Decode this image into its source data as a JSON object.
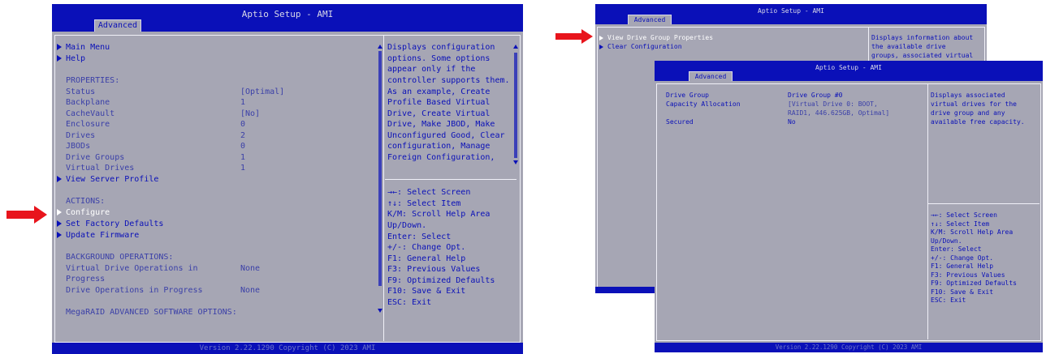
{
  "screen1": {
    "title": "Aptio Setup - AMI",
    "tab": "Advanced",
    "menu": [
      {
        "label": "Main Menu",
        "value": ""
      },
      {
        "label": "Help",
        "value": ""
      }
    ],
    "properties_header": "PROPERTIES:",
    "properties": [
      {
        "label": "Status",
        "value": "[Optimal]"
      },
      {
        "label": "Backplane",
        "value": "1"
      },
      {
        "label": "CacheVault",
        "value": "[No]"
      },
      {
        "label": "Enclosure",
        "value": "0"
      },
      {
        "label": "Drives",
        "value": "2"
      },
      {
        "label": "JBODs",
        "value": "0"
      },
      {
        "label": "Drive Groups",
        "value": "1"
      },
      {
        "label": "Virtual Drives",
        "value": "1"
      }
    ],
    "view_server_profile": "View Server Profile",
    "actions_header": "ACTIONS:",
    "actions": [
      "Configure",
      "Set Factory Defaults",
      "Update Firmware"
    ],
    "background_header": "BACKGROUND OPERATIONS:",
    "bg_ops": [
      {
        "label1": "Virtual Drive Operations in",
        "label2": "Progress",
        "value": "None"
      },
      {
        "label1": "Drive Operations in Progress",
        "label2": "",
        "value": "None"
      }
    ],
    "software_header": "MegaRAID ADVANCED SOFTWARE OPTIONS:",
    "help_lines": [
      "Displays configuration",
      "options. Some options",
      "appear only if the",
      "controller supports them.",
      "As an example, Create",
      "Profile Based Virtual",
      "Drive, Create Virtual",
      "Drive, Make JBOD, Make",
      "Unconfigured Good, Clear",
      "configuration, Manage",
      "Foreign Configuration,"
    ],
    "keys": [
      "→←: Select Screen",
      "↑↓: Select Item",
      "K/M: Scroll Help Area",
      "Up/Down.",
      "Enter: Select",
      "+/-: Change Opt.",
      "F1: General Help",
      "F3: Previous Values",
      "F9: Optimized Defaults",
      "F10: Save & Exit",
      "ESC: Exit"
    ],
    "footer": "Version 2.22.1290 Copyright (C) 2023 AMI"
  },
  "screen2": {
    "title": "Aptio Setup - AMI",
    "tab": "Advanced",
    "items": [
      "View Drive Group Properties",
      "Clear Configuration"
    ],
    "help_lines": [
      "Displays information about",
      "the available drive",
      "groups, associated virtual"
    ]
  },
  "screen3": {
    "title": "Aptio Setup - AMI",
    "tab": "Advanced",
    "rows": [
      {
        "label": "Drive Group",
        "value": "Drive Group #0"
      },
      {
        "label": "Capacity Allocation",
        "value": "[Virtual Drive 0: BOOT,"
      },
      {
        "label": "",
        "value": "RAID1, 446.625GB, Optimal]"
      },
      {
        "label": "Secured",
        "value": "No"
      }
    ],
    "help_lines": [
      "Displays associated",
      "virtual drives for the",
      "drive group and any",
      "available free capacity."
    ],
    "keys": [
      "→←: Select Screen",
      "↑↓: Select Item",
      "K/M: Scroll Help Area",
      "Up/Down.",
      "Enter: Select",
      "+/-: Change Opt.",
      "F1: General Help",
      "F3: Previous Values",
      "F9: Optimized Defaults",
      "F10: Save & Exit",
      "ESC: Exit"
    ],
    "footer": "Version 2.22.1290 Copyright (C) 2023 AMI"
  },
  "colors": {
    "header": "#0a10b8",
    "body": "#a6a6b4",
    "arrow": "#e8141c",
    "text": "#0a10b8"
  }
}
